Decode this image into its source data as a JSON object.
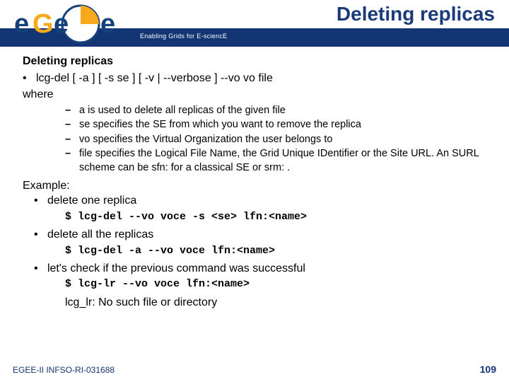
{
  "header": {
    "tagline": "Enabling Grids for E-sciencE",
    "title": "Deleting replicas"
  },
  "section": {
    "heading": "Deleting replicas",
    "command": "lcg-del  [ -a ] [ -s se ] [ -v | --verbose ] --vo vo file",
    "where": "where"
  },
  "options": [
    {
      "key": "a",
      "desc": " is used to delete all replicas of the given file"
    },
    {
      "key": "se",
      "desc": " specifies the SE from which you want to remove the replica"
    },
    {
      "key": "vo",
      "desc": " specifies the Virtual Organization the user belongs to"
    },
    {
      "key": "file",
      "desc": " specifies  the Logical  File Name, the Grid Unique IDentifier or the Site URL.  An SURL scheme can be sfn: for a classical SE or srm: ."
    }
  ],
  "example": {
    "label": "Example:",
    "items": [
      {
        "text": "delete one replica",
        "code": "$ lcg-del --vo voce -s <se> lfn:<name>"
      },
      {
        "text": "delete all the replicas",
        "code": "$ lcg-del -a --vo voce lfn:<name>"
      },
      {
        "text": "let's check if the previous command was successful",
        "code": "$ lcg-lr --vo voce lfn:<name>"
      }
    ],
    "result": "lcg_lr: No such file or directory"
  },
  "footer": {
    "left": "EGEE-II INFSO-RI-031688",
    "right": "109"
  },
  "logo": {
    "text_e1": "e",
    "text_g": "G",
    "text_e2": "e",
    "text_e3": "e"
  }
}
